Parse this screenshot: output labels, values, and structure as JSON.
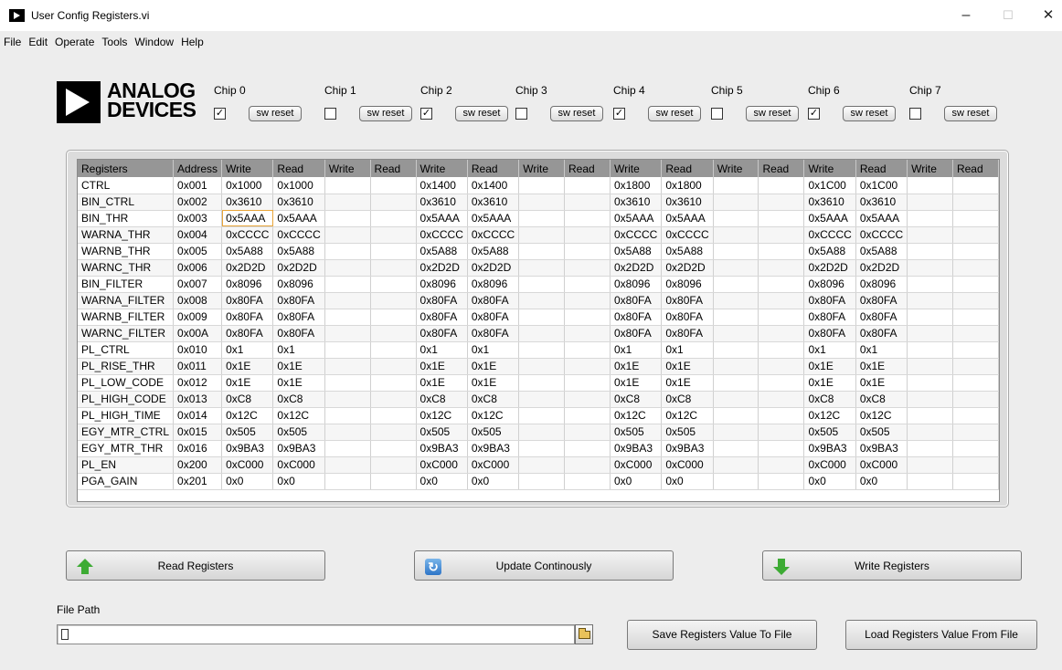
{
  "window": {
    "title": "User Config Registers.vi",
    "minimize": "–",
    "maximize": "☐",
    "close": "✕"
  },
  "menu": [
    "File",
    "Edit",
    "Operate",
    "Tools",
    "Window",
    "Help"
  ],
  "logo": {
    "line1": "ANALOG",
    "line2": "DEVICES"
  },
  "chips": [
    {
      "label": "Chip 0",
      "checked": true,
      "reset_label": "sw reset"
    },
    {
      "label": "Chip 1",
      "checked": false,
      "reset_label": "sw reset"
    },
    {
      "label": "Chip 2",
      "checked": true,
      "reset_label": "sw reset"
    },
    {
      "label": "Chip 3",
      "checked": false,
      "reset_label": "sw reset"
    },
    {
      "label": "Chip 4",
      "checked": true,
      "reset_label": "sw reset"
    },
    {
      "label": "Chip 5",
      "checked": false,
      "reset_label": "sw reset"
    },
    {
      "label": "Chip 6",
      "checked": true,
      "reset_label": "sw reset"
    },
    {
      "label": "Chip 7",
      "checked": false,
      "reset_label": "sw reset"
    }
  ],
  "table": {
    "headers": [
      "Registers",
      "Address",
      "Write",
      "Read",
      "Write",
      "Read",
      "Write",
      "Read",
      "Write",
      "Read",
      "Write",
      "Read",
      "Write",
      "Read",
      "Write",
      "Read",
      "Write",
      "Read"
    ],
    "rows": [
      [
        "CTRL",
        "0x001",
        "0x1000",
        "0x1000",
        "",
        "",
        "0x1400",
        "0x1400",
        "",
        "",
        "0x1800",
        "0x1800",
        "",
        "",
        "0x1C00",
        "0x1C00",
        "",
        ""
      ],
      [
        "BIN_CTRL",
        "0x002",
        "0x3610",
        "0x3610",
        "",
        "",
        "0x3610",
        "0x3610",
        "",
        "",
        "0x3610",
        "0x3610",
        "",
        "",
        "0x3610",
        "0x3610",
        "",
        ""
      ],
      [
        "BIN_THR",
        "0x003",
        "0x5AAA",
        "0x5AAA",
        "",
        "",
        "0x5AAA",
        "0x5AAA",
        "",
        "",
        "0x5AAA",
        "0x5AAA",
        "",
        "",
        "0x5AAA",
        "0x5AAA",
        "",
        ""
      ],
      [
        "WARNA_THR",
        "0x004",
        "0xCCCC",
        "0xCCCC",
        "",
        "",
        "0xCCCC",
        "0xCCCC",
        "",
        "",
        "0xCCCC",
        "0xCCCC",
        "",
        "",
        "0xCCCC",
        "0xCCCC",
        "",
        ""
      ],
      [
        "WARNB_THR",
        "0x005",
        "0x5A88",
        "0x5A88",
        "",
        "",
        "0x5A88",
        "0x5A88",
        "",
        "",
        "0x5A88",
        "0x5A88",
        "",
        "",
        "0x5A88",
        "0x5A88",
        "",
        ""
      ],
      [
        "WARNC_THR",
        "0x006",
        "0x2D2D",
        "0x2D2D",
        "",
        "",
        "0x2D2D",
        "0x2D2D",
        "",
        "",
        "0x2D2D",
        "0x2D2D",
        "",
        "",
        "0x2D2D",
        "0x2D2D",
        "",
        ""
      ],
      [
        "BIN_FILTER",
        "0x007",
        "0x8096",
        "0x8096",
        "",
        "",
        "0x8096",
        "0x8096",
        "",
        "",
        "0x8096",
        "0x8096",
        "",
        "",
        "0x8096",
        "0x8096",
        "",
        ""
      ],
      [
        "WARNA_FILTER",
        "0x008",
        "0x80FA",
        "0x80FA",
        "",
        "",
        "0x80FA",
        "0x80FA",
        "",
        "",
        "0x80FA",
        "0x80FA",
        "",
        "",
        "0x80FA",
        "0x80FA",
        "",
        ""
      ],
      [
        "WARNB_FILTER",
        "0x009",
        "0x80FA",
        "0x80FA",
        "",
        "",
        "0x80FA",
        "0x80FA",
        "",
        "",
        "0x80FA",
        "0x80FA",
        "",
        "",
        "0x80FA",
        "0x80FA",
        "",
        ""
      ],
      [
        "WARNC_FILTER",
        "0x00A",
        "0x80FA",
        "0x80FA",
        "",
        "",
        "0x80FA",
        "0x80FA",
        "",
        "",
        "0x80FA",
        "0x80FA",
        "",
        "",
        "0x80FA",
        "0x80FA",
        "",
        ""
      ],
      [
        "PL_CTRL",
        "0x010",
        "0x1",
        "0x1",
        "",
        "",
        "0x1",
        "0x1",
        "",
        "",
        "0x1",
        "0x1",
        "",
        "",
        "0x1",
        "0x1",
        "",
        ""
      ],
      [
        "PL_RISE_THR",
        "0x011",
        "0x1E",
        "0x1E",
        "",
        "",
        "0x1E",
        "0x1E",
        "",
        "",
        "0x1E",
        "0x1E",
        "",
        "",
        "0x1E",
        "0x1E",
        "",
        ""
      ],
      [
        "PL_LOW_CODE",
        "0x012",
        "0x1E",
        "0x1E",
        "",
        "",
        "0x1E",
        "0x1E",
        "",
        "",
        "0x1E",
        "0x1E",
        "",
        "",
        "0x1E",
        "0x1E",
        "",
        ""
      ],
      [
        "PL_HIGH_CODE",
        "0x013",
        "0xC8",
        "0xC8",
        "",
        "",
        "0xC8",
        "0xC8",
        "",
        "",
        "0xC8",
        "0xC8",
        "",
        "",
        "0xC8",
        "0xC8",
        "",
        ""
      ],
      [
        "PL_HIGH_TIME",
        "0x014",
        "0x12C",
        "0x12C",
        "",
        "",
        "0x12C",
        "0x12C",
        "",
        "",
        "0x12C",
        "0x12C",
        "",
        "",
        "0x12C",
        "0x12C",
        "",
        ""
      ],
      [
        "EGY_MTR_CTRL",
        "0x015",
        "0x505",
        "0x505",
        "",
        "",
        "0x505",
        "0x505",
        "",
        "",
        "0x505",
        "0x505",
        "",
        "",
        "0x505",
        "0x505",
        "",
        ""
      ],
      [
        "EGY_MTR_THR",
        "0x016",
        "0x9BA3",
        "0x9BA3",
        "",
        "",
        "0x9BA3",
        "0x9BA3",
        "",
        "",
        "0x9BA3",
        "0x9BA3",
        "",
        "",
        "0x9BA3",
        "0x9BA3",
        "",
        ""
      ],
      [
        "PL_EN",
        "0x200",
        "0xC000",
        "0xC000",
        "",
        "",
        "0xC000",
        "0xC000",
        "",
        "",
        "0xC000",
        "0xC000",
        "",
        "",
        "0xC000",
        "0xC000",
        "",
        ""
      ],
      [
        "PGA_GAIN",
        "0x201",
        "0x0",
        "0x0",
        "",
        "",
        "0x0",
        "0x0",
        "",
        "",
        "0x0",
        "0x0",
        "",
        "",
        "0x0",
        "0x0",
        "",
        ""
      ]
    ]
  },
  "buttons": {
    "read": "Read  Registers",
    "update": "Update  Continously",
    "write": "Write Registers",
    "save": "Save Registers Value To File",
    "load": "Load Registers Value From File"
  },
  "file_path": {
    "label": "File Path",
    "value": ""
  },
  "icons": {
    "read": "green-up-arrow-icon",
    "update": "refresh-icon",
    "write": "green-down-arrow-icon",
    "browse": "folder-icon"
  }
}
